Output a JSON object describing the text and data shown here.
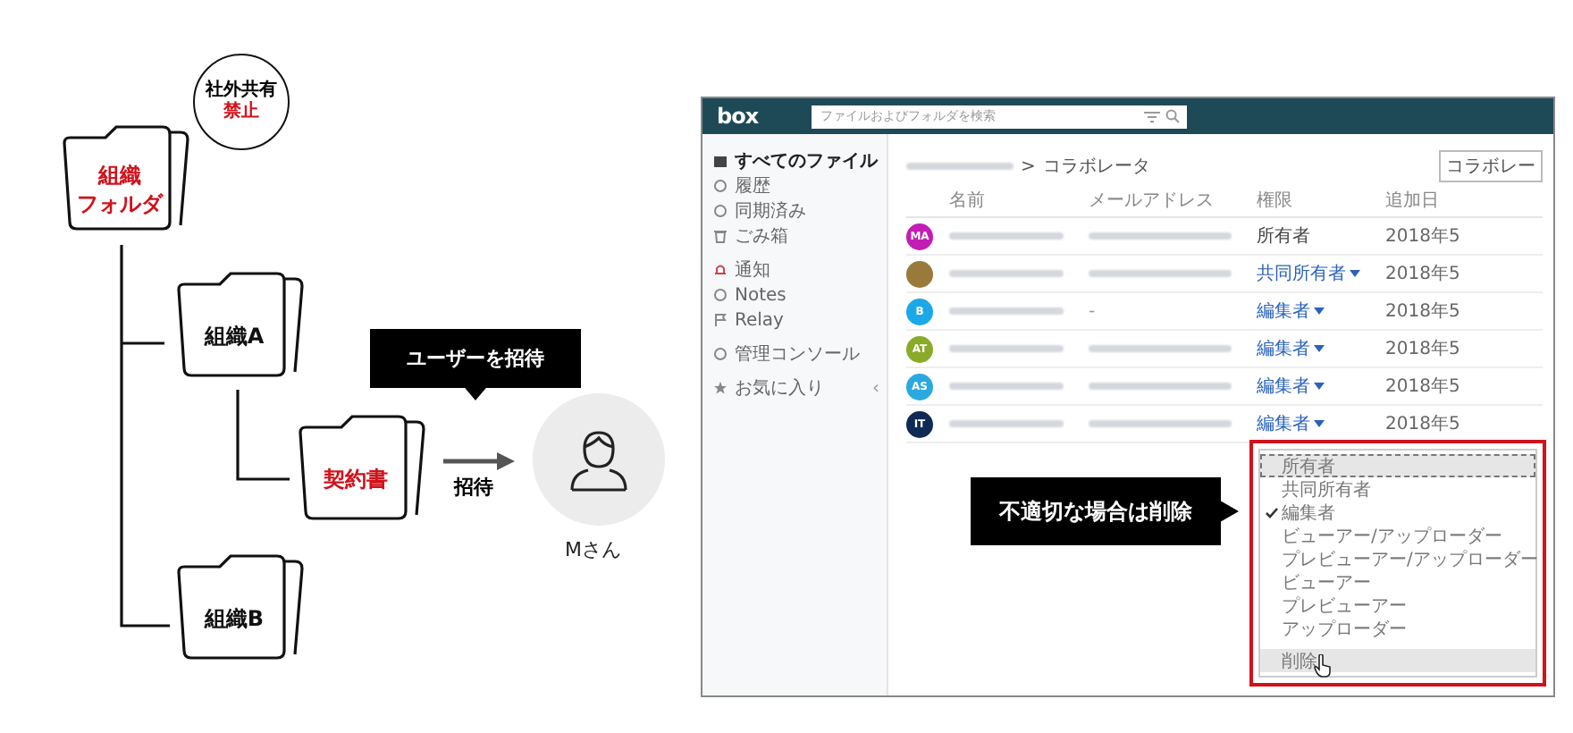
{
  "diagram": {
    "notice_bubble": {
      "line_1": "社外共有",
      "line_2": "禁止"
    },
    "folders": [
      {
        "label_lines": [
          "組織",
          "フォルダ"
        ],
        "highlighted": true
      },
      {
        "label_lines": [
          "組織A"
        ],
        "highlighted": false
      },
      {
        "label_lines": [
          "契約書"
        ],
        "highlighted": true
      },
      {
        "label_lines": [
          "組織B"
        ],
        "highlighted": false
      }
    ],
    "tooltip": "ユーザーを招待",
    "arrow_label": "招待",
    "person": "Mさん"
  },
  "app": {
    "logo": "box",
    "search_placeholder": "ファイルおよびフォルダを検索",
    "sidebar_groups": [
      [
        {
          "label": "すべてのファイル",
          "selected": true
        },
        {
          "label": "履歴",
          "selected": false
        },
        {
          "label": "同期済み",
          "selected": false
        },
        {
          "label": "ごみ箱",
          "selected": false
        }
      ],
      [
        {
          "label": "通知",
          "selected": false
        },
        {
          "label": "Notes",
          "selected": false
        },
        {
          "label": "Relay",
          "selected": false
        }
      ],
      [
        {
          "label": "管理コンソール",
          "selected": false
        }
      ],
      [
        {
          "label": "お気に入り",
          "selected": false,
          "toggle": "‹"
        }
      ]
    ],
    "breadcrumb": {
      "separator": ">",
      "current": "コラボレータ"
    },
    "add_button": "コラボレー",
    "columns": [
      "名前",
      "メールアドレス",
      "権限",
      "追加日"
    ],
    "rows": [
      {
        "avatar": {
          "kind": "initials",
          "initials": "MA",
          "color": "#c21db5"
        },
        "role": "所有者",
        "role_dropdown": false,
        "date": "2018年5"
      },
      {
        "avatar": {
          "kind": "photo"
        },
        "role": "共同所有者",
        "role_dropdown": true,
        "date": "2018年5"
      },
      {
        "avatar": {
          "kind": "initials",
          "initials": "B",
          "color": "#1aa8e8"
        },
        "email": "-",
        "role": "編集者",
        "role_dropdown": true,
        "date": "2018年5"
      },
      {
        "avatar": {
          "kind": "initials",
          "initials": "AT",
          "color": "#8aaa2a"
        },
        "role": "編集者",
        "role_dropdown": true,
        "date": "2018年5"
      },
      {
        "avatar": {
          "kind": "initials",
          "initials": "AS",
          "color": "#2aa8e0"
        },
        "role": "編集者",
        "role_dropdown": true,
        "date": "2018年5"
      },
      {
        "avatar": {
          "kind": "initials",
          "initials": "IT",
          "color": "#0f2a55"
        },
        "role": "編集者",
        "role_dropdown": true,
        "date": "2018年5"
      }
    ],
    "dropdown": {
      "options": [
        {
          "label": "所有者",
          "checked": false,
          "focused": true,
          "hovered": false
        },
        {
          "label": "共同所有者",
          "checked": false,
          "focused": false,
          "hovered": false
        },
        {
          "label": "編集者",
          "checked": true,
          "focused": false,
          "hovered": false
        },
        {
          "label": "ビューアー/アップローダー",
          "checked": false,
          "focused": false,
          "hovered": false
        },
        {
          "label": "プレビューアー/アップローダー",
          "checked": false,
          "focused": false,
          "hovered": false
        },
        {
          "label": "ビューアー",
          "checked": false,
          "focused": false,
          "hovered": false
        },
        {
          "label": "プレビューアー",
          "checked": false,
          "focused": false,
          "hovered": false
        },
        {
          "label": "アップローダー",
          "checked": false,
          "focused": false,
          "hovered": false
        },
        {
          "label": "削除",
          "checked": false,
          "focused": false,
          "hovered": true
        }
      ]
    },
    "callout": "不適切な場合は削除"
  }
}
